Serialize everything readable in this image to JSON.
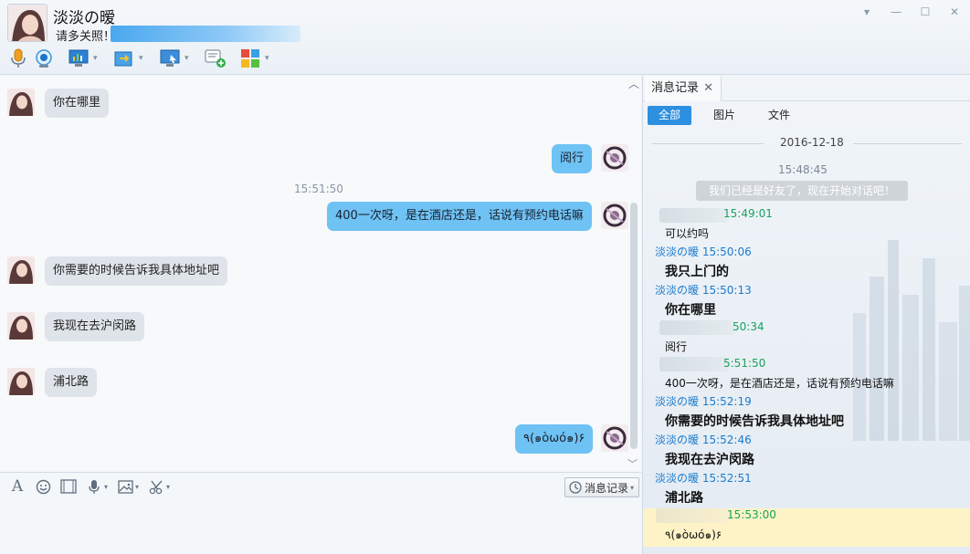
{
  "header": {
    "contact_name": "淡淡の暧",
    "signature": "请多关照！"
  },
  "window_controls": {
    "menu": "▾",
    "minimize": "—",
    "maximize": "☐",
    "close": "✕"
  },
  "toolbar": {
    "icons": [
      "microphone-icon",
      "camera-icon",
      "screen-share-icon",
      "file-transfer-icon",
      "remote-desktop-icon",
      "add-chat-icon",
      "apps-icon"
    ]
  },
  "chat": {
    "messages": [
      {
        "side": "left",
        "text": "你在哪里"
      },
      {
        "side": "right",
        "text": "阅行"
      },
      {
        "side": "right",
        "text": "400一次呀，是在酒店还是，话说有预约电话嘛"
      },
      {
        "side": "left",
        "text": "你需要的时候告诉我具体地址吧"
      },
      {
        "side": "left",
        "text": "我现在去沪闵路"
      },
      {
        "side": "left",
        "text": "浦北路"
      },
      {
        "side": "right",
        "text": "٩(๑òωó๑)۶"
      }
    ],
    "timestamp": "15:51:50"
  },
  "input_bar": {
    "history_label": "消息记录",
    "history_arrow": "▾",
    "arrow": "▾"
  },
  "panel": {
    "tab_label": "消息记录",
    "tab_close": "✕",
    "filters": [
      "全部",
      "图片",
      "文件"
    ],
    "active_filter": "全部",
    "date": "2016-12-18",
    "first_time": "15:48:45",
    "notice": "我们已经是好友了，现在开始对话吧！",
    "records": [
      {
        "who": "",
        "time": "15:49:01",
        "text": "可以约吗",
        "bold": false
      },
      {
        "who": "淡淡の暧",
        "time": "15:50:06",
        "text": "我只上门的",
        "bold": true
      },
      {
        "who": "淡淡の暧",
        "time": "15:50:13",
        "text": "你在哪里",
        "bold": true
      },
      {
        "who": "",
        "time": "50:34",
        "text": "阅行",
        "bold": false
      },
      {
        "who": "",
        "time": "5:51:50",
        "text": "400一次呀，是在酒店还是，话说有预约电话嘛",
        "bold": false
      },
      {
        "who": "淡淡の暧",
        "time": "15:52:19",
        "text": "你需要的时候告诉我具体地址吧",
        "bold": true
      },
      {
        "who": "淡淡の暧",
        "time": "15:52:46",
        "text": "我现在去沪闵路",
        "bold": true
      },
      {
        "who": "淡淡の暧",
        "time": "15:52:51",
        "text": "浦北路",
        "bold": true
      },
      {
        "who": "",
        "time": "15:53:00",
        "text": "٩(๑òωó๑)۶",
        "bold": false
      }
    ]
  }
}
